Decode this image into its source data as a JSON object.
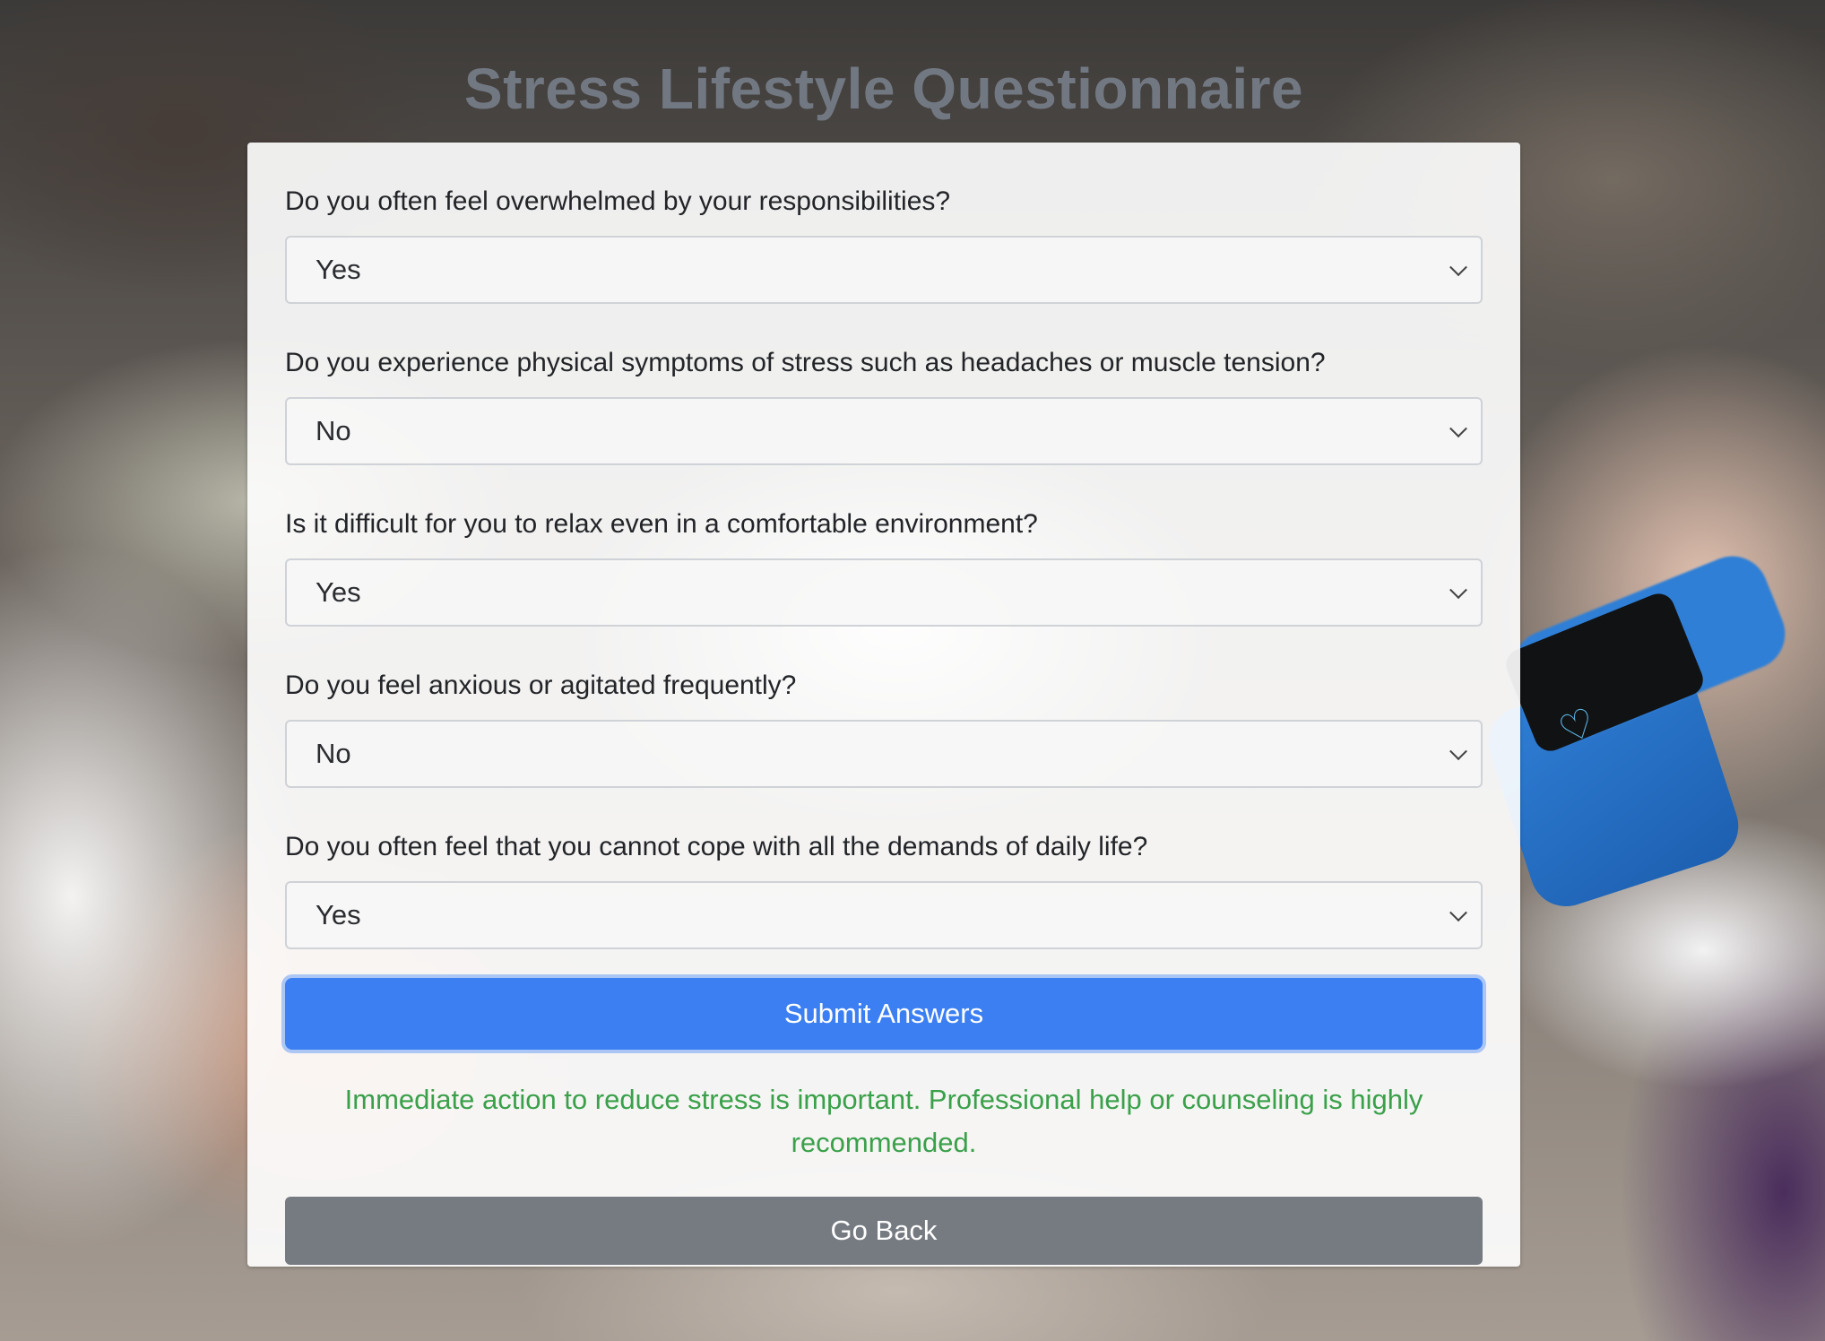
{
  "page": {
    "title": "Stress Lifestyle Questionnaire"
  },
  "questions": [
    {
      "label": "Do you often feel overwhelmed by your responsibilities?",
      "selected": "Yes"
    },
    {
      "label": "Do you experience physical symptoms of stress such as headaches or muscle tension?",
      "selected": "No"
    },
    {
      "label": "Is it difficult for you to relax even in a comfortable environment?",
      "selected": "Yes"
    },
    {
      "label": "Do you feel anxious or agitated frequently?",
      "selected": "No"
    },
    {
      "label": "Do you often feel that you cannot cope with all the demands of daily life?",
      "selected": "Yes"
    }
  ],
  "actions": {
    "submit_label": "Submit Answers",
    "back_label": "Go Back"
  },
  "result": {
    "message": "Immediate action to reduce stress is important. Professional help or counseling is highly recommended."
  },
  "colors": {
    "submit_button": "#3b7ff2",
    "back_button": "#767b82",
    "result_text": "#3aa04a",
    "title_text": "#727882"
  }
}
